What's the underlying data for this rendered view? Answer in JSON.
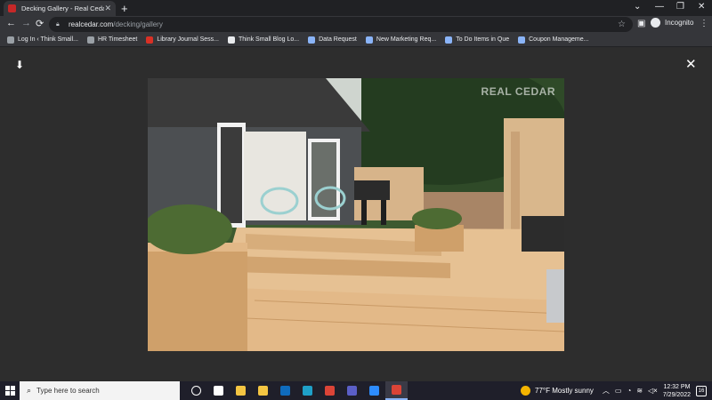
{
  "browser": {
    "tab": {
      "title": "Decking Gallery - Real Cedar",
      "close": "✕"
    },
    "new_tab": "+",
    "window_controls": {
      "dropdown": "⌄",
      "minimize": "—",
      "restore": "❐",
      "close": "✕"
    },
    "nav": {
      "back": "←",
      "forward": "→",
      "reload": "⟳"
    },
    "url": {
      "host": "realcedar.com",
      "path": "/decking/gallery"
    },
    "incognito_label": "Incognito",
    "bookmarks": [
      {
        "label": "Log In ‹ Think Small...",
        "color": "#9aa0a6"
      },
      {
        "label": "HR Timesheet",
        "color": "#9aa0a6"
      },
      {
        "label": "Library Journal Sess...",
        "color": "#d93025"
      },
      {
        "label": "Think Small Blog Lo...",
        "color": "#e8eaed"
      },
      {
        "label": "Data Request",
        "color": "#8ab4f8"
      },
      {
        "label": "New Marketing Req...",
        "color": "#8ab4f8"
      },
      {
        "label": "To Do Items in Que",
        "color": "#8ab4f8"
      },
      {
        "label": "Coupon Manageme...",
        "color": "#8ab4f8"
      }
    ]
  },
  "viewer": {
    "download_icon": "⬇",
    "close_icon": "✕",
    "watermark": "REAL CEDAR",
    "image_alt": "Cedar deck with planters, chairs and grill"
  },
  "taskbar": {
    "search_placeholder": "Type here to search",
    "weather": "77°F  Mostly sunny",
    "time": "12:32 PM",
    "date": "7/29/2022",
    "notification_count": "16",
    "apps": [
      {
        "name": "task-view",
        "color": "#ffffff"
      },
      {
        "name": "widgets",
        "color": "#ffffff"
      },
      {
        "name": "file-explorer",
        "color": "#f4c542"
      },
      {
        "name": "store",
        "color": "#f4c542"
      },
      {
        "name": "outlook",
        "color": "#0f6cbd"
      },
      {
        "name": "edge",
        "color": "#1fa0c8"
      },
      {
        "name": "chrome",
        "color": "#db4437"
      },
      {
        "name": "teams",
        "color": "#5b5fc7"
      },
      {
        "name": "zoom",
        "color": "#2d8cff"
      },
      {
        "name": "chrome-incognito",
        "color": "#db4437"
      }
    ]
  }
}
